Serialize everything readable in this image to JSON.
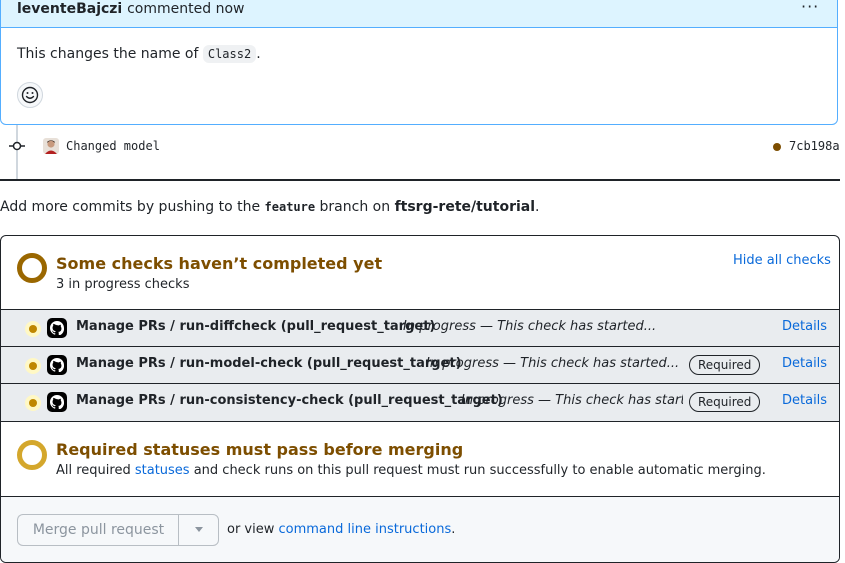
{
  "comment": {
    "author": "leventeBajczi",
    "time": "commented now",
    "menu": "···",
    "body_prefix": "This changes the name of ",
    "body_code": "Class2",
    "body_suffix": "."
  },
  "timeline": {
    "commit_message": "Changed model",
    "commit_sha": "7cb198a"
  },
  "hint": {
    "prefix": "Add more commits by pushing to the ",
    "branch": "feature",
    "middle": " branch on ",
    "repo": "ftsrg-rete/tutorial",
    "suffix": "."
  },
  "checks": {
    "title": "Some checks haven’t completed yet",
    "subtitle": "3 in progress checks",
    "hide_label": "Hide all checks",
    "items": [
      {
        "name": "Manage PRs / run-diffcheck (pull_request_target)",
        "description": "In progress — This check has started...",
        "required": "",
        "details": "Details"
      },
      {
        "name": "Manage PRs / run-model-check (pull_request_target)",
        "description": "In progress — This check has started...",
        "required": "Required",
        "details": "Details"
      },
      {
        "name": "Manage PRs / run-consistency-check (pull_request_target)",
        "description": "In progress — This check has started...",
        "required": "Required",
        "details": "Details"
      }
    ]
  },
  "required_statuses": {
    "title": "Required statuses must pass before merging",
    "prefix": "All required ",
    "link": "statuses",
    "suffix": " and check runs on this pull request must run successfully to enable automatic merging."
  },
  "merge": {
    "button": "Merge pull request",
    "or_view": "or view ",
    "cli_link": "command line instructions",
    "cli_suffix": "."
  },
  "colors": {
    "pending_dark": "#9a6700",
    "pending_light": "#d4a72c",
    "link": "#0969da",
    "comment_header_bg": "#ddf4ff",
    "comment_border": "#54aeff"
  }
}
